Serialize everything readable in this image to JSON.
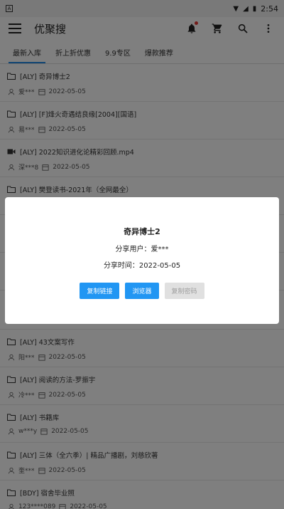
{
  "status": {
    "time": "2:54",
    "left_badge": "A"
  },
  "appbar": {
    "title": "优聚搜"
  },
  "tabs": [
    {
      "label": "最新入库",
      "active": true
    },
    {
      "label": "折上折优惠",
      "active": false
    },
    {
      "label": "9.9专区",
      "active": false
    },
    {
      "label": "爆款推荐",
      "active": false
    }
  ],
  "items": [
    {
      "icon": "folder-icon",
      "name": "[ALY] 奇异博士2",
      "user": "爱***",
      "date": "2022-05-05"
    },
    {
      "icon": "folder-icon",
      "name": "[ALY] [F]烽火奇遇结良缘[2004][国语]",
      "user": "易***",
      "date": "2022-05-05"
    },
    {
      "icon": "video-icon",
      "name": "[ALY] 2022知识进化论精彩回顾.mp4",
      "user": "深***8",
      "date": "2022-05-05"
    },
    {
      "icon": "folder-icon",
      "name": "[ALY] 樊登读书-2021年（全网最全）",
      "user": "",
      "date": ""
    },
    {
      "icon": "folder-icon",
      "name": "",
      "user": "",
      "date": ""
    },
    {
      "icon": "folder-icon",
      "name": "",
      "user": "",
      "date": ""
    },
    {
      "icon": "folder-icon",
      "name": "[ALY] 43文案写作",
      "user": "阳***",
      "date": "2022-05-05"
    },
    {
      "icon": "folder-icon",
      "name": "[ALY] 阅读的方法-罗振宇",
      "user": "冷***",
      "date": "2022-05-05"
    },
    {
      "icon": "folder-icon",
      "name": "[ALY] 书籍库",
      "user": "w***y",
      "date": "2022-05-05"
    },
    {
      "icon": "folder-icon",
      "name": "[ALY] 三体（全六季）| 精品广播剧，刘慈欣著",
      "user": "奎***",
      "date": "2022-05-05"
    },
    {
      "icon": "folder-icon",
      "name": "[BDY] 宿舍毕业照",
      "user": "123****089",
      "date": "2022-05-05"
    }
  ],
  "dialog": {
    "title": "奇异博士2",
    "user_line": "分享用户：爱***",
    "time_line": "分享时间：2022-05-05",
    "buttons": {
      "copy_link": "复制链接",
      "browser": "浏览器",
      "copy_password": "复制密码"
    }
  },
  "colors": {
    "accent": "#2196f3",
    "tab_indicator": "#1e88e5",
    "badge": "#e53935"
  }
}
